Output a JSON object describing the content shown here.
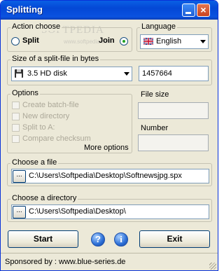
{
  "window": {
    "title": "Splitting"
  },
  "watermark": {
    "text": "SOFTPEDIA",
    "url": "www.softpedia.com"
  },
  "action": {
    "group_label": "Action choose",
    "split_label": "Split",
    "join_label": "Join",
    "selected": "join"
  },
  "language": {
    "group_label": "Language",
    "value": "English"
  },
  "size": {
    "group_label": "Size of a split-file in bytes",
    "disk_value": "3.5 HD disk",
    "bytes_value": "1457664"
  },
  "options": {
    "group_label": "Options",
    "items": [
      "Create batch-file",
      "New directory",
      "Split to A:",
      "Compare checksum"
    ],
    "more_label": "More options"
  },
  "file_size": {
    "group_label": "File size",
    "value": ""
  },
  "number": {
    "group_label": "Number",
    "value": ""
  },
  "choose_file": {
    "group_label": "Choose a file",
    "browse_label": "...",
    "value": "C:\\Users\\Softpedia\\Desktop\\Softnewsjpg.spx"
  },
  "choose_dir": {
    "group_label": "Choose a directory",
    "browse_label": "...",
    "value": "C:\\Users\\Softpedia\\Desktop\\"
  },
  "buttons": {
    "start_label": "Start",
    "help_label": "?",
    "info_label": "i",
    "exit_label": "Exit"
  },
  "status": {
    "text": "Sponsored by : www.blue-series.de"
  }
}
